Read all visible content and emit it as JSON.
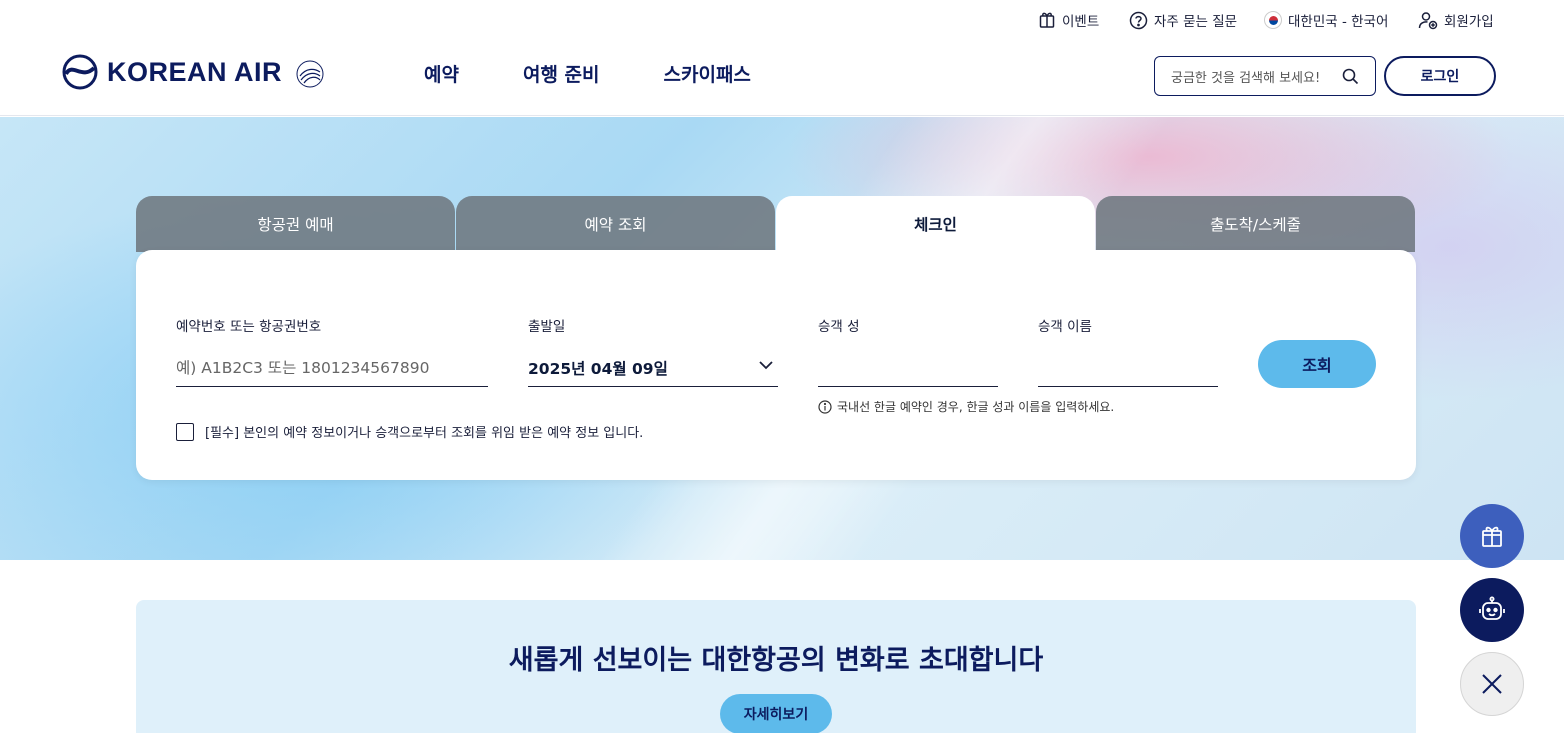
{
  "util": {
    "event": "이벤트",
    "faq": "자주 묻는 질문",
    "lang": "대한민국 - 한국어",
    "signup": "회원가입"
  },
  "header": {
    "logo_text": "KOREAN AIR",
    "nav": [
      "예약",
      "여행 준비",
      "스카이패스"
    ],
    "search_placeholder": "궁금한 것을 검색해 보세요!",
    "login": "로그인"
  },
  "tabs": [
    {
      "label": "항공권 예매",
      "active": false
    },
    {
      "label": "예약 조회",
      "active": false
    },
    {
      "label": "체크인",
      "active": true
    },
    {
      "label": "출도착/스케줄",
      "active": false
    }
  ],
  "checkin": {
    "booking_label": "예약번호 또는 항공권번호",
    "booking_placeholder": "예) A1B2C3 또는 1801234567890",
    "date_label": "출발일",
    "date_value": "2025년 04월 09일",
    "lastname_label": "승객 성",
    "firstname_label": "승객 이름",
    "hint": "국내선 한글 예약인 경우, 한글 성과 이름을 입력하세요.",
    "agree_text": "[필수] 본인의 예약 정보이거나 승객으로부터 조회를 위임 받은 예약 정보 입니다.",
    "search_button": "조회"
  },
  "promo": {
    "title": "새롭게 선보이는 대한항공의 변화로 초대합니다",
    "button": "자세히보기"
  },
  "colors": {
    "brand_navy": "#0c1b5e",
    "accent_sky": "#5dbaeb",
    "tab_inactive": "#6e7880"
  }
}
